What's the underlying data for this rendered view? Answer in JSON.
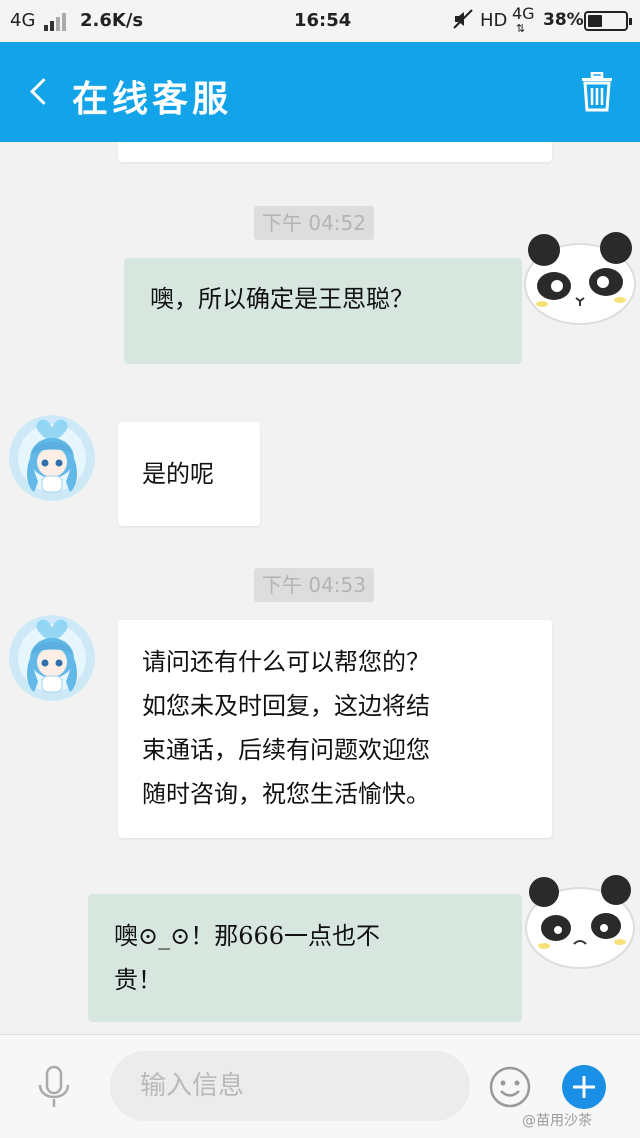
{
  "status_bar": {
    "network_type": "4G",
    "data_speed": "2.6K/s",
    "time": "16:54",
    "hd_label": "HD",
    "network_type_right": "4G",
    "battery_percent": "38%",
    "battery_level": 0.38
  },
  "header": {
    "title": "在线客服",
    "color": "#12a3e8"
  },
  "messages": [
    {
      "type": "timestamp",
      "text": "下午 04:52"
    },
    {
      "type": "outgoing",
      "text": "噢，所以确定是王思聪？"
    },
    {
      "type": "incoming",
      "text": "是的呢"
    },
    {
      "type": "timestamp",
      "text": "下午 04:53"
    },
    {
      "type": "incoming",
      "lines": [
        "请问还有什么可以帮您的？",
        "如您未及时回复，这边将结",
        "束通话，后续有问题欢迎您",
        "随时咨询，祝您生活愉快。"
      ]
    },
    {
      "type": "outgoing",
      "lines": [
        "噢⊙_⊙！那666一点也不",
        "贵！"
      ]
    }
  ],
  "input": {
    "placeholder": "输入信息"
  },
  "watermark": "@苗用沙茶",
  "colors": {
    "outgoing_bubble": "#d7e7df",
    "incoming_bubble": "#ffffff",
    "add_button": "#1a8fe6"
  }
}
